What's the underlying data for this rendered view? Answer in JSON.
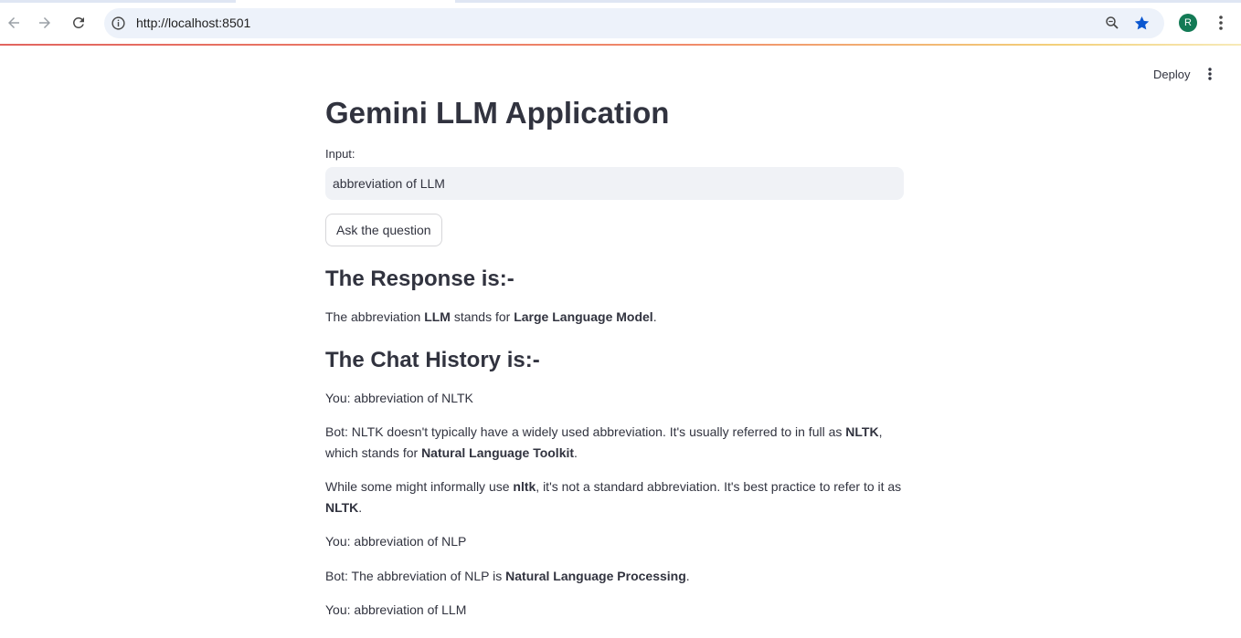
{
  "browser": {
    "url": "http://localhost:8501",
    "avatar_letter": "R",
    "icons": [
      "back-icon",
      "forward-icon",
      "reload-icon",
      "site-info-icon",
      "zoom-icon",
      "bookmark-star-icon",
      "kebab-menu-icon"
    ],
    "colors": {
      "star": "#0b57d0",
      "avatar": "#137a55",
      "omnibox": "#edf2fa"
    }
  },
  "header": {
    "deploy_label": "Deploy"
  },
  "app": {
    "title": "Gemini LLM Application",
    "input_label": "Input:",
    "input_value": "abbreviation of LLM",
    "ask_button_label": "Ask the question",
    "response_heading": "The Response is:-",
    "response": {
      "t1": "The abbreviation ",
      "b1": "LLM",
      "t2": " stands for ",
      "b2": "Large Language Model",
      "t3": "."
    },
    "history_heading": "The Chat History is:-",
    "history": {
      "m1": "You: abbreviation of NLTK",
      "m2": {
        "t1": "Bot: NLTK doesn't typically have a widely used abbreviation. It's usually referred to in full as ",
        "b1": "NLTK",
        "t2": ", which stands for ",
        "b2": "Natural Language Toolkit",
        "t3": "."
      },
      "m3": {
        "t1": "While some might informally use ",
        "b1": "nltk",
        "t2": ", it's not a standard abbreviation. It's best practice to refer to it as ",
        "b2": "NLTK",
        "t3": "."
      },
      "m4": "You: abbreviation of NLP",
      "m5": {
        "t1": "Bot: The abbreviation of NLP is ",
        "b1": "Natural Language Processing",
        "t2": "."
      },
      "m6": "You: abbreviation of LLM"
    }
  }
}
